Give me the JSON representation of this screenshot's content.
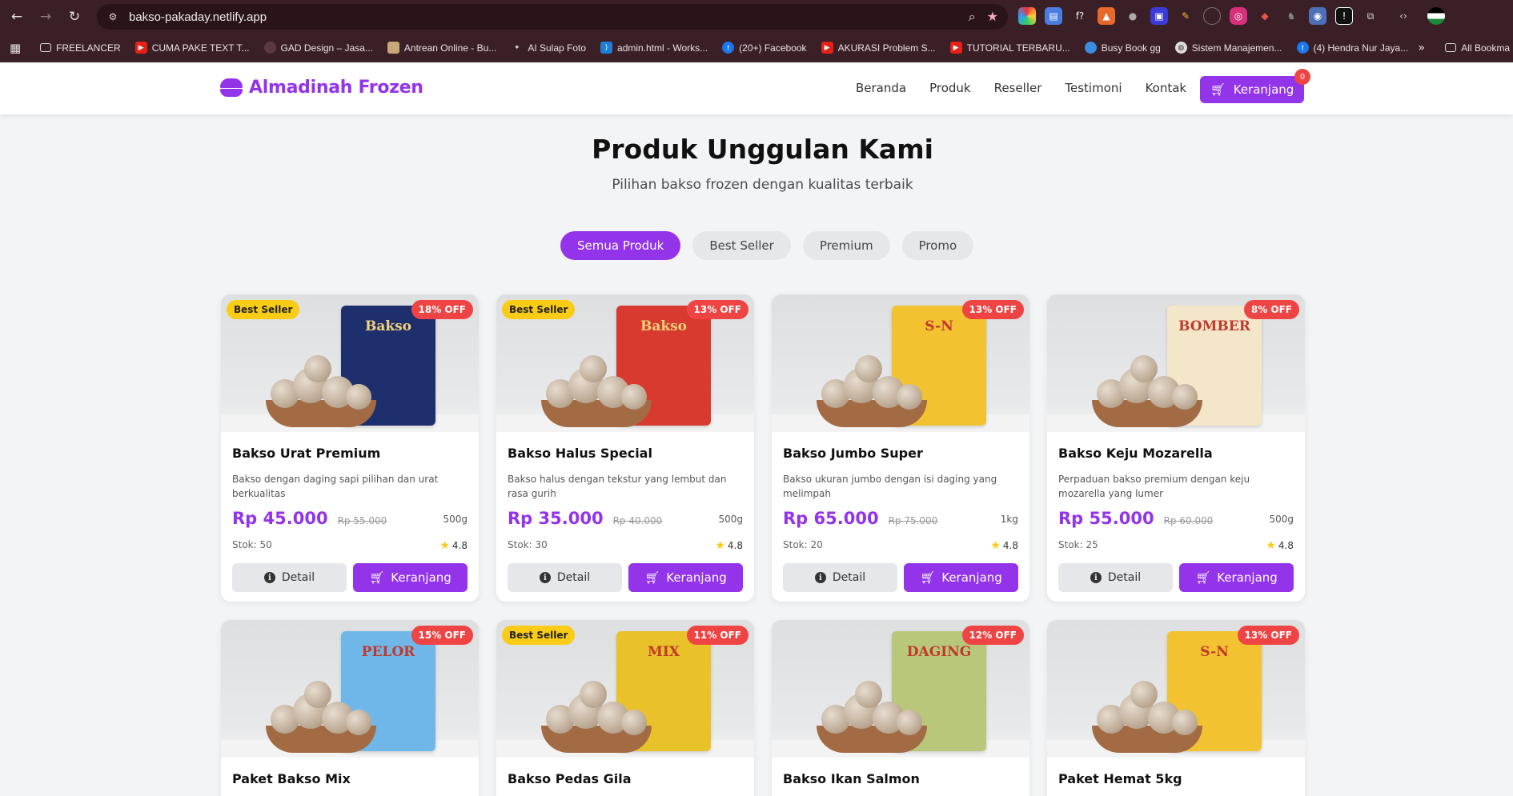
{
  "browser": {
    "url": "bakso-pakaday.netlify.app",
    "bookmarks": [
      {
        "label": "FREELANCER",
        "icon": "folder-icon"
      },
      {
        "label": "CUMA PAKE TEXT T...",
        "icon": "youtube-icon"
      },
      {
        "label": "GAD Design – Jasa...",
        "icon": "site-icon"
      },
      {
        "label": "Antrean Online - Bu...",
        "icon": "site-icon"
      },
      {
        "label": "AI Sulap Foto",
        "icon": "site-icon"
      },
      {
        "label": "admin.html - Works...",
        "icon": "vscode-icon"
      },
      {
        "label": "(20+) Facebook",
        "icon": "facebook-icon"
      },
      {
        "label": "AKURASI Problem S...",
        "icon": "youtube-icon"
      },
      {
        "label": "TUTORIAL TERBARU...",
        "icon": "youtube-icon"
      },
      {
        "label": "Busy Book gg",
        "icon": "site-icon"
      },
      {
        "label": "Sistem Manajemen...",
        "icon": "globe-icon"
      },
      {
        "label": "(4) Hendra Nur Jaya...",
        "icon": "facebook-icon"
      }
    ],
    "more_label": "»",
    "all_bookmarks": "All Bookma"
  },
  "site": {
    "brand": "Almadinah Frozen",
    "nav": [
      "Beranda",
      "Produk",
      "Reseller",
      "Testimoni",
      "Kontak"
    ],
    "cart_label": "Keranjang",
    "cart_count": "0"
  },
  "section": {
    "title": "Produk Unggulan Kami",
    "subtitle": "Pilihan bakso frozen dengan kualitas terbaik"
  },
  "filters": [
    "Semua Produk",
    "Best Seller",
    "Premium",
    "Promo"
  ],
  "buttons": {
    "detail": "Detail",
    "cart": "Keranjang"
  },
  "products": [
    {
      "name": "Bakso Urat Premium",
      "desc": "Bakso dengan daging sapi pilihan dan urat berkualitas",
      "price": "Rp 45.000",
      "old_price": "Rp 55.000",
      "weight": "500g",
      "stock": "Stok: 50",
      "rating": "4.8",
      "best": "Best Seller",
      "off": "18% OFF",
      "pack_text": "Bakso",
      "pack_color": "#1e2f6e"
    },
    {
      "name": "Bakso Halus Special",
      "desc": "Bakso halus dengan tekstur yang lembut dan rasa gurih",
      "price": "Rp 35.000",
      "old_price": "Rp 40.000",
      "weight": "500g",
      "stock": "Stok: 30",
      "rating": "4.8",
      "best": "Best Seller",
      "off": "13% OFF",
      "pack_text": "Bakso",
      "pack_color": "#d93a2f"
    },
    {
      "name": "Bakso Jumbo Super",
      "desc": "Bakso ukuran jumbo dengan isi daging yang melimpah",
      "price": "Rp 65.000",
      "old_price": "Rp 75.000",
      "weight": "1kg",
      "stock": "Stok: 20",
      "rating": "4.8",
      "best": "",
      "off": "13% OFF",
      "pack_text": "S-N",
      "pack_color": "#f2c230"
    },
    {
      "name": "Bakso Keju Mozarella",
      "desc": "Perpaduan bakso premium dengan keju mozarella yang lumer",
      "price": "Rp 55.000",
      "old_price": "Rp 60.000",
      "weight": "500g",
      "stock": "Stok: 25",
      "rating": "4.8",
      "best": "",
      "off": "8% OFF",
      "pack_text": "BOMBER",
      "pack_color": "#f3e6c9"
    },
    {
      "name": "Paket Bakso Mix",
      "off": "15% OFF",
      "best": "",
      "pack_text": "PELOR",
      "pack_color": "#6fb7e8"
    },
    {
      "name": "Bakso Pedas Gila",
      "off": "11% OFF",
      "best": "Best Seller",
      "pack_text": "MIX",
      "pack_color": "#e9c22a"
    },
    {
      "name": "Bakso Ikan Salmon",
      "off": "12% OFF",
      "best": "",
      "pack_text": "DAGING",
      "pack_color": "#b8c77a"
    },
    {
      "name": "Paket Hemat 5kg",
      "off": "13% OFF",
      "best": "",
      "pack_text": "S-N",
      "pack_color": "#f2c230"
    }
  ]
}
